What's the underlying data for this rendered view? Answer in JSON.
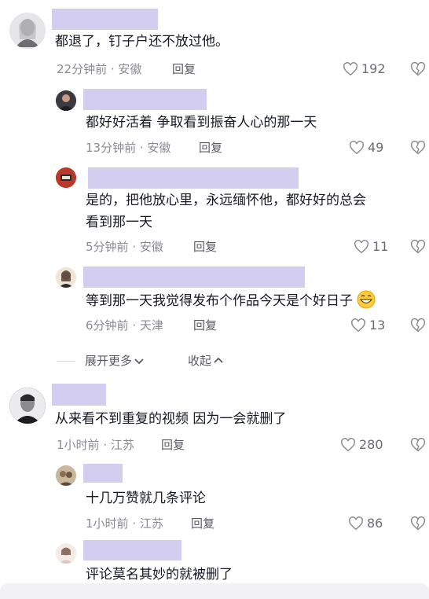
{
  "comments": [
    {
      "text": "都退了，钉子户还不放过他。",
      "time": "22分钟前",
      "location": "安徽",
      "reply_label": "回复",
      "likes": "192",
      "replies": [
        {
          "text": "都好好活着  争取看到振奋人心的那一天",
          "time": "13分钟前",
          "location": "安徽",
          "reply_label": "回复",
          "likes": "49"
        },
        {
          "text_line1": "是的，把他放心里，永远缅怀他，都好好的总会",
          "text_line2": "看到那一天",
          "time": "5分钟前",
          "location": "安徽",
          "reply_label": "回复",
          "likes": "11"
        },
        {
          "text": "等到那一天我觉得发布个作品今天是个好日子",
          "time": "6分钟前",
          "location": "天津",
          "reply_label": "回复",
          "likes": "13"
        }
      ],
      "expand_more": "展开更多",
      "collapse": "收起"
    },
    {
      "text": "从来看不到重复的视频  因为一会就删了",
      "time": "1小时前",
      "location": "江苏",
      "reply_label": "回复",
      "likes": "280",
      "replies": [
        {
          "text": "十几万赞就几条评论",
          "time": "1小时前",
          "location": "江苏",
          "reply_label": "回复",
          "likes": "86"
        },
        {
          "text": "评论莫名其妙的就被删了"
        }
      ]
    }
  ],
  "meta_separator": " · ",
  "icons": {
    "like": "heart-outline-icon",
    "dislike": "broken-heart-icon",
    "emoji": "grinning-face-emoji",
    "chevron_down": "chevron-down-icon",
    "chevron_up": "chevron-up-icon"
  }
}
